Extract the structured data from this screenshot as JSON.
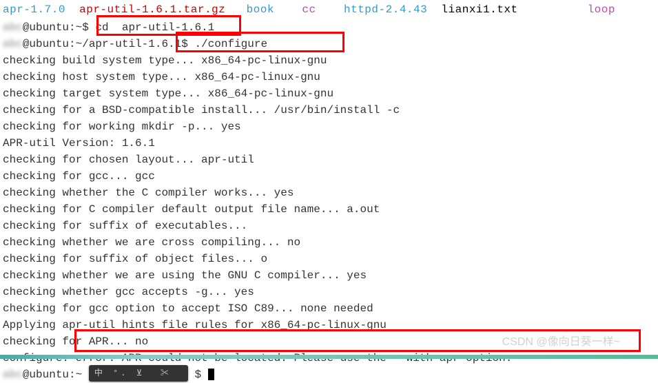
{
  "file_list": {
    "items": [
      {
        "name": "apr-1.7.0",
        "cls": "cyan"
      },
      {
        "name": "apr-util-1.6.1.tar.gz",
        "cls": "red"
      },
      {
        "name": "book",
        "cls": "cyan"
      },
      {
        "name": "cc",
        "cls": "magenta"
      },
      {
        "name": "httpd-2.4.43",
        "cls": "cyan"
      },
      {
        "name": "lianxi1.txt",
        "cls": "black"
      },
      {
        "name": "loop",
        "cls": "magenta"
      }
    ]
  },
  "prompt1": {
    "user_host": "@ubuntu:~$ ",
    "cmd": "cd  apr-util-1.6.1"
  },
  "prompt2": {
    "user_host": "@ubuntu:~/apr-util-1.6.1$",
    "cmd": " ./configure"
  },
  "output": [
    "checking build system type... x86_64-pc-linux-gnu",
    "checking host system type... x86_64-pc-linux-gnu",
    "checking target system type... x86_64-pc-linux-gnu",
    "checking for a BSD-compatible install... /usr/bin/install -c",
    "checking for working mkdir -p... yes",
    "APR-util Version: 1.6.1",
    "checking for chosen layout... apr-util",
    "checking for gcc... gcc",
    "checking whether the C compiler works... yes",
    "checking for C compiler default output file name... a.out",
    "checking for suffix of executables...",
    "checking whether we are cross compiling... no",
    "checking for suffix of object files... o",
    "checking whether we are using the GNU C compiler... yes",
    "checking whether gcc accepts -g... yes",
    "checking for gcc option to accept ISO C89... none needed",
    "Applying apr-util hints file rules for x86_64-pc-linux-gnu",
    "checking for APR... no"
  ],
  "error_line": {
    "prefix": "configure: ",
    "msg": "error: APR could not be located. Please use the --with-apr option."
  },
  "prompt3": {
    "user_host": "@ubuntu:~",
    "suffix": "$ "
  },
  "ime": {
    "label": "中 °. ⊻  ✂"
  },
  "watermark": "CSDN @像向日葵一样~"
}
